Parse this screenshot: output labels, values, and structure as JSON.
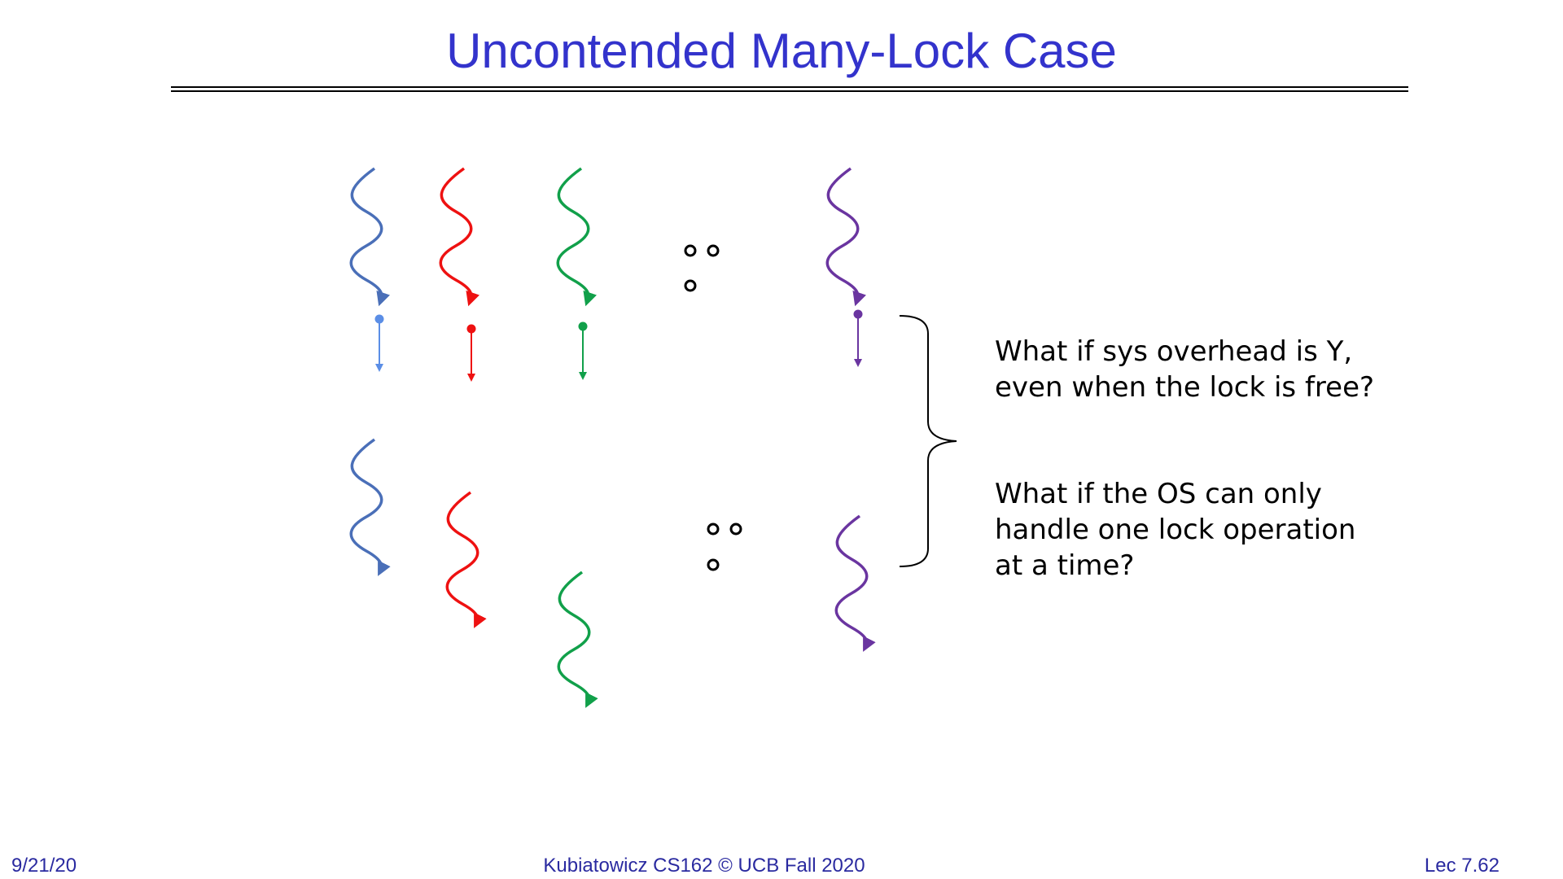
{
  "slide": {
    "title": "Uncontended Many-Lock Case",
    "questions": [
      "What if sys overhead is Y, even when the lock is free?",
      "What if the OS can only handle one lock operation at a time?"
    ],
    "footer": {
      "date": "9/21/20",
      "course": "Kubiatowicz CS162 © UCB Fall 2020",
      "lecture": "Lec 7.62"
    }
  },
  "colors": {
    "title": "#3333cc",
    "footer": "#2a2aa0",
    "thread_blue": "#4a6fb8",
    "thread_blue_light": "#5b8ee6",
    "thread_red": "#ee1111",
    "thread_green": "#11a04a",
    "thread_purple": "#6a35a0"
  },
  "threads": [
    {
      "name": "blue",
      "color": "#4a6fb8",
      "lock_color": "#5b8ee6"
    },
    {
      "name": "red",
      "color": "#ee1111",
      "lock_color": "#ee1111"
    },
    {
      "name": "green",
      "color": "#11a04a",
      "lock_color": "#11a04a"
    },
    {
      "name": "purple",
      "color": "#6a35a0",
      "lock_color": "#6a35a0"
    }
  ]
}
